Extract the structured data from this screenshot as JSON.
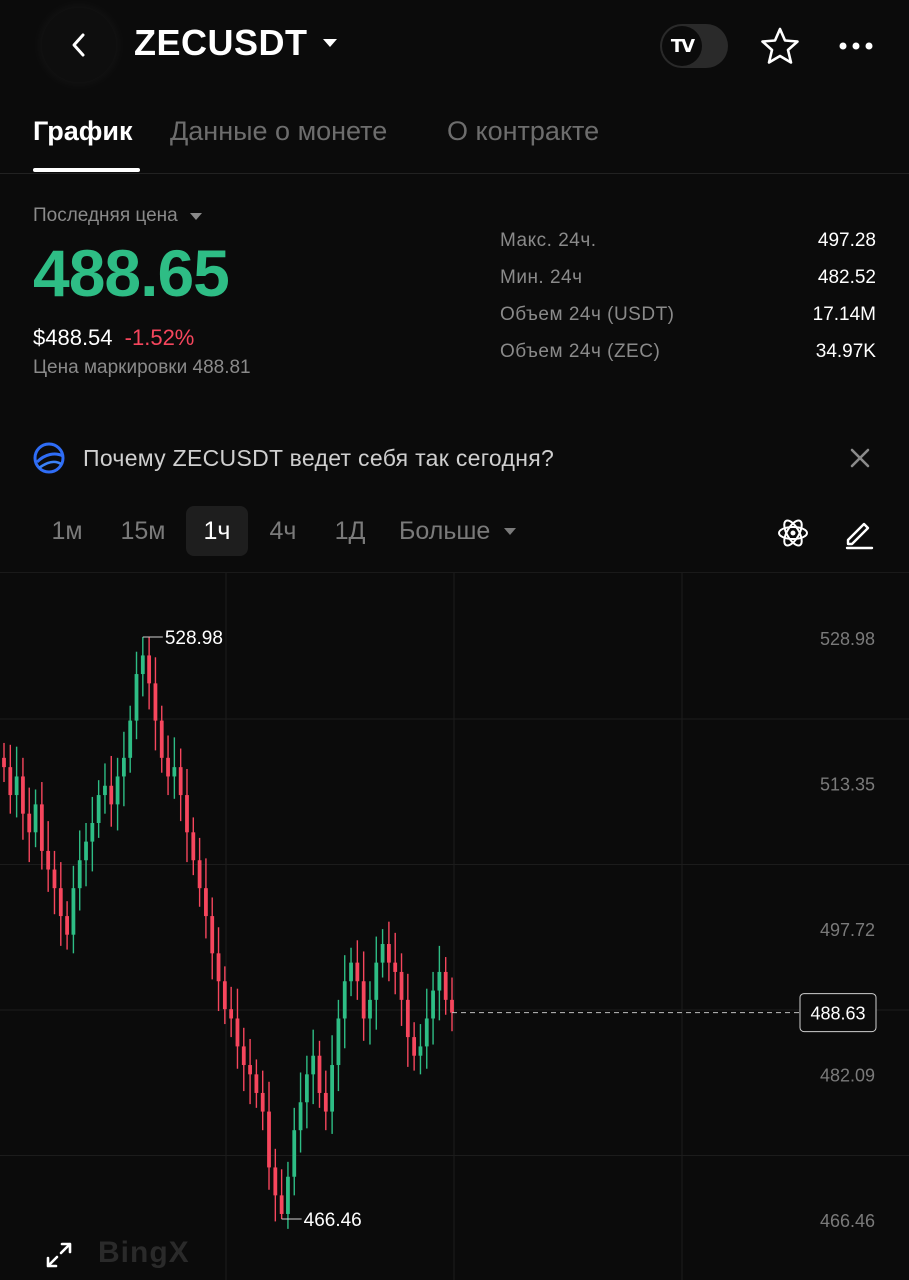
{
  "header": {
    "pair": "ZECUSDT",
    "tv_logo": "TV",
    "icons": [
      "back-arrow-icon",
      "caret-down-icon",
      "tradingview-icon",
      "star-icon",
      "more-icon"
    ]
  },
  "tabs": [
    {
      "label": "График",
      "active": true
    },
    {
      "label": "Данные о монете",
      "active": false
    },
    {
      "label": "О контракте",
      "active": false
    }
  ],
  "price": {
    "label": "Последняя цена",
    "last": "488.65",
    "usd": "$488.54",
    "change": "-1.52%",
    "mark": "Цена маркировки 488.81"
  },
  "stats": [
    {
      "label": "Макс. 24ч.",
      "value": "497.28"
    },
    {
      "label": "Мин. 24ч",
      "value": "482.52"
    },
    {
      "label": "Объем 24ч (USDT)",
      "value": "17.14M"
    },
    {
      "label": "Объем 24ч (ZEC)",
      "value": "34.97K"
    }
  ],
  "ai_banner": {
    "text": "Почему ZECUSDT ведет себя так сегодня?"
  },
  "intervals": [
    {
      "label": "1м",
      "active": false
    },
    {
      "label": "15м",
      "active": false
    },
    {
      "label": "1ч",
      "active": true
    },
    {
      "label": "4ч",
      "active": false
    },
    {
      "label": "1Д",
      "active": false
    },
    {
      "label": "Больше",
      "active": false
    }
  ],
  "chart_data": {
    "type": "candlestick",
    "price_axis_ticks": [
      "528.98",
      "513.35",
      "497.72",
      "482.09",
      "466.46"
    ],
    "current_price_label": "488.63",
    "high_label": "528.98",
    "low_label": "466.46",
    "close_series": [
      515,
      512,
      514,
      510,
      508,
      511,
      506,
      504,
      502,
      499,
      497,
      502,
      505,
      507,
      509,
      512,
      513,
      511,
      514,
      516,
      520,
      525,
      527,
      524,
      520,
      516,
      514,
      515,
      512,
      508,
      505,
      502,
      499,
      495,
      492,
      489,
      488,
      485,
      483,
      482,
      480,
      478,
      472,
      469,
      467,
      471,
      476,
      479,
      482,
      484,
      480,
      478,
      483,
      488,
      492,
      494,
      492,
      488,
      490,
      494,
      496,
      494,
      493,
      490,
      486,
      484,
      485,
      488,
      491,
      493,
      490,
      488.63
    ],
    "colors": {
      "up": "#2ebd85",
      "down": "#f6465d"
    }
  },
  "watermark": "BingX"
}
